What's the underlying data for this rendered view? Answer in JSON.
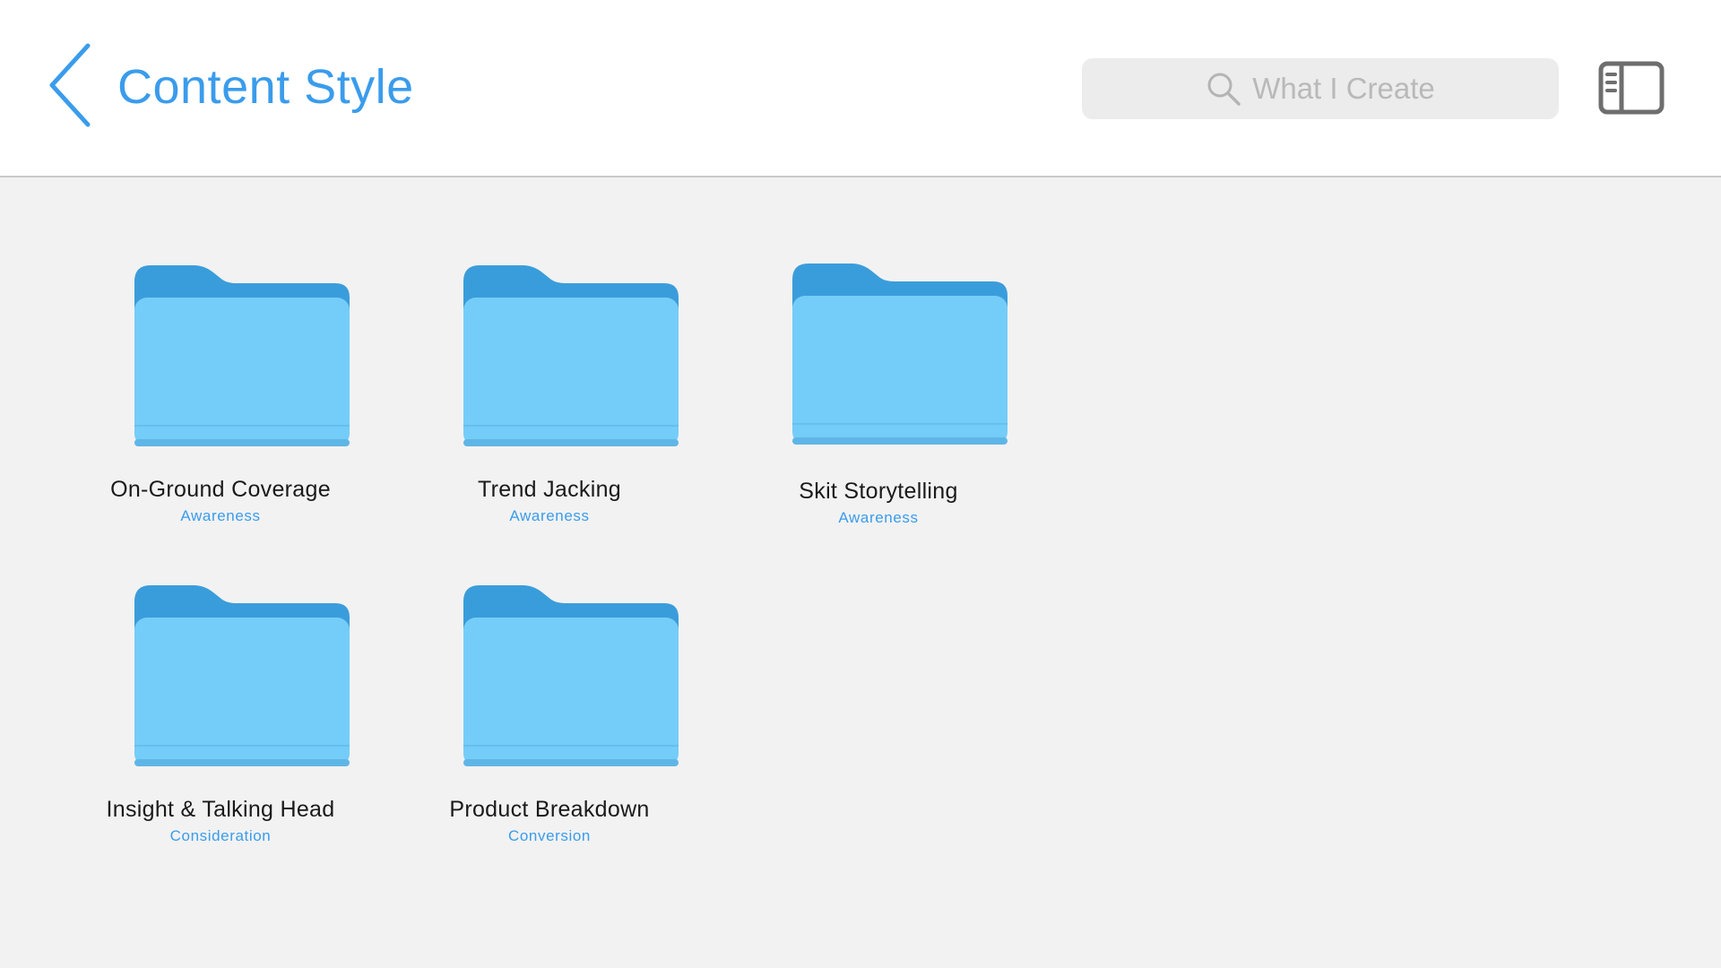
{
  "header": {
    "title": "Content Style",
    "back_icon": "chevron-left-icon",
    "search": {
      "placeholder": "What I Create",
      "value": ""
    },
    "sidebar_icon": "sidebar-toggle-icon"
  },
  "colors": {
    "accent": "#3a9cec",
    "folder_front": "#74cdf8",
    "folder_back": "#3a9ddb",
    "background": "#f2f2f2"
  },
  "folders": [
    {
      "name": "On-Ground Coverage",
      "tag": "Awareness",
      "icon": "folder-icon"
    },
    {
      "name": "Trend Jacking",
      "tag": "Awareness",
      "icon": "folder-icon"
    },
    {
      "name": "Skit Storytelling",
      "tag": "Awareness",
      "icon": "folder-icon"
    },
    {
      "name": "Insight & Talking Head",
      "tag": "Consideration",
      "icon": "folder-icon"
    },
    {
      "name": "Product Breakdown",
      "tag": "Conversion",
      "icon": "folder-icon"
    }
  ]
}
